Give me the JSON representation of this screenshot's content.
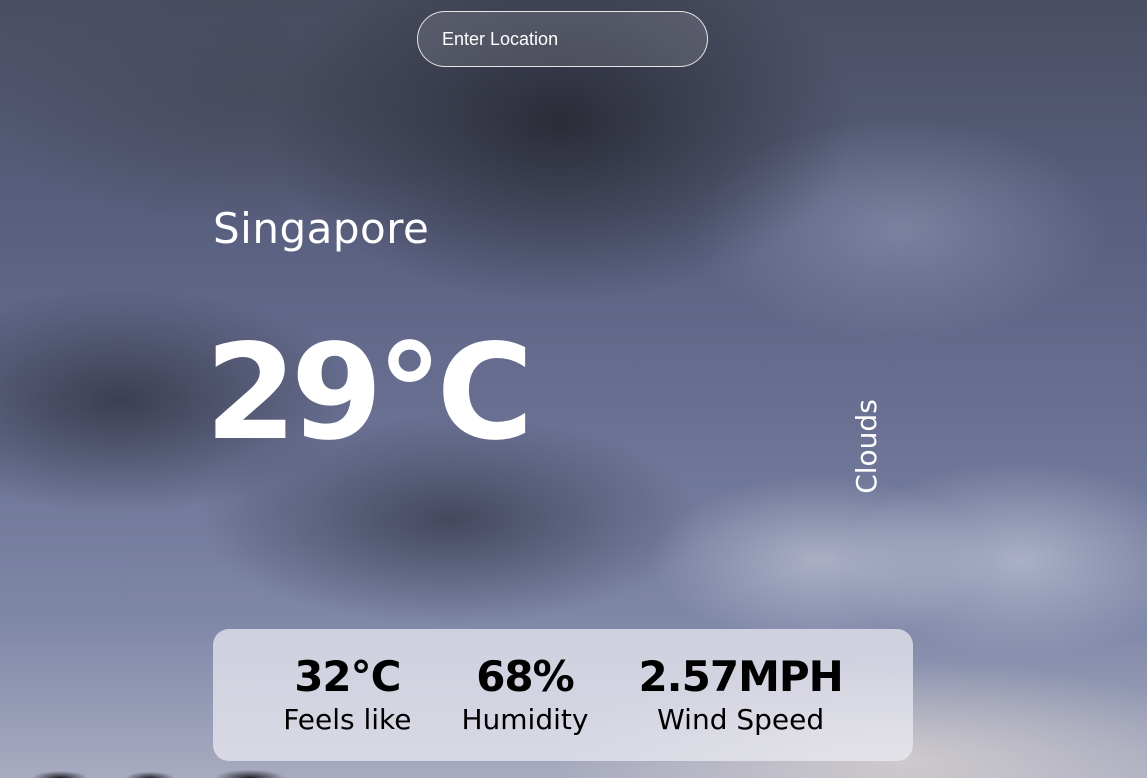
{
  "search": {
    "placeholder": "Enter Location"
  },
  "weather": {
    "city": "Singapore",
    "temperature": "29°C",
    "condition": "Clouds"
  },
  "stats": [
    {
      "value": "32°C",
      "label": "Feels like"
    },
    {
      "value": "68%",
      "label": "Humidity"
    },
    {
      "value": "2.57MPH",
      "label": "Wind Speed"
    }
  ],
  "colors": {
    "text_primary": "#ffffff",
    "panel_text": "#000000"
  }
}
